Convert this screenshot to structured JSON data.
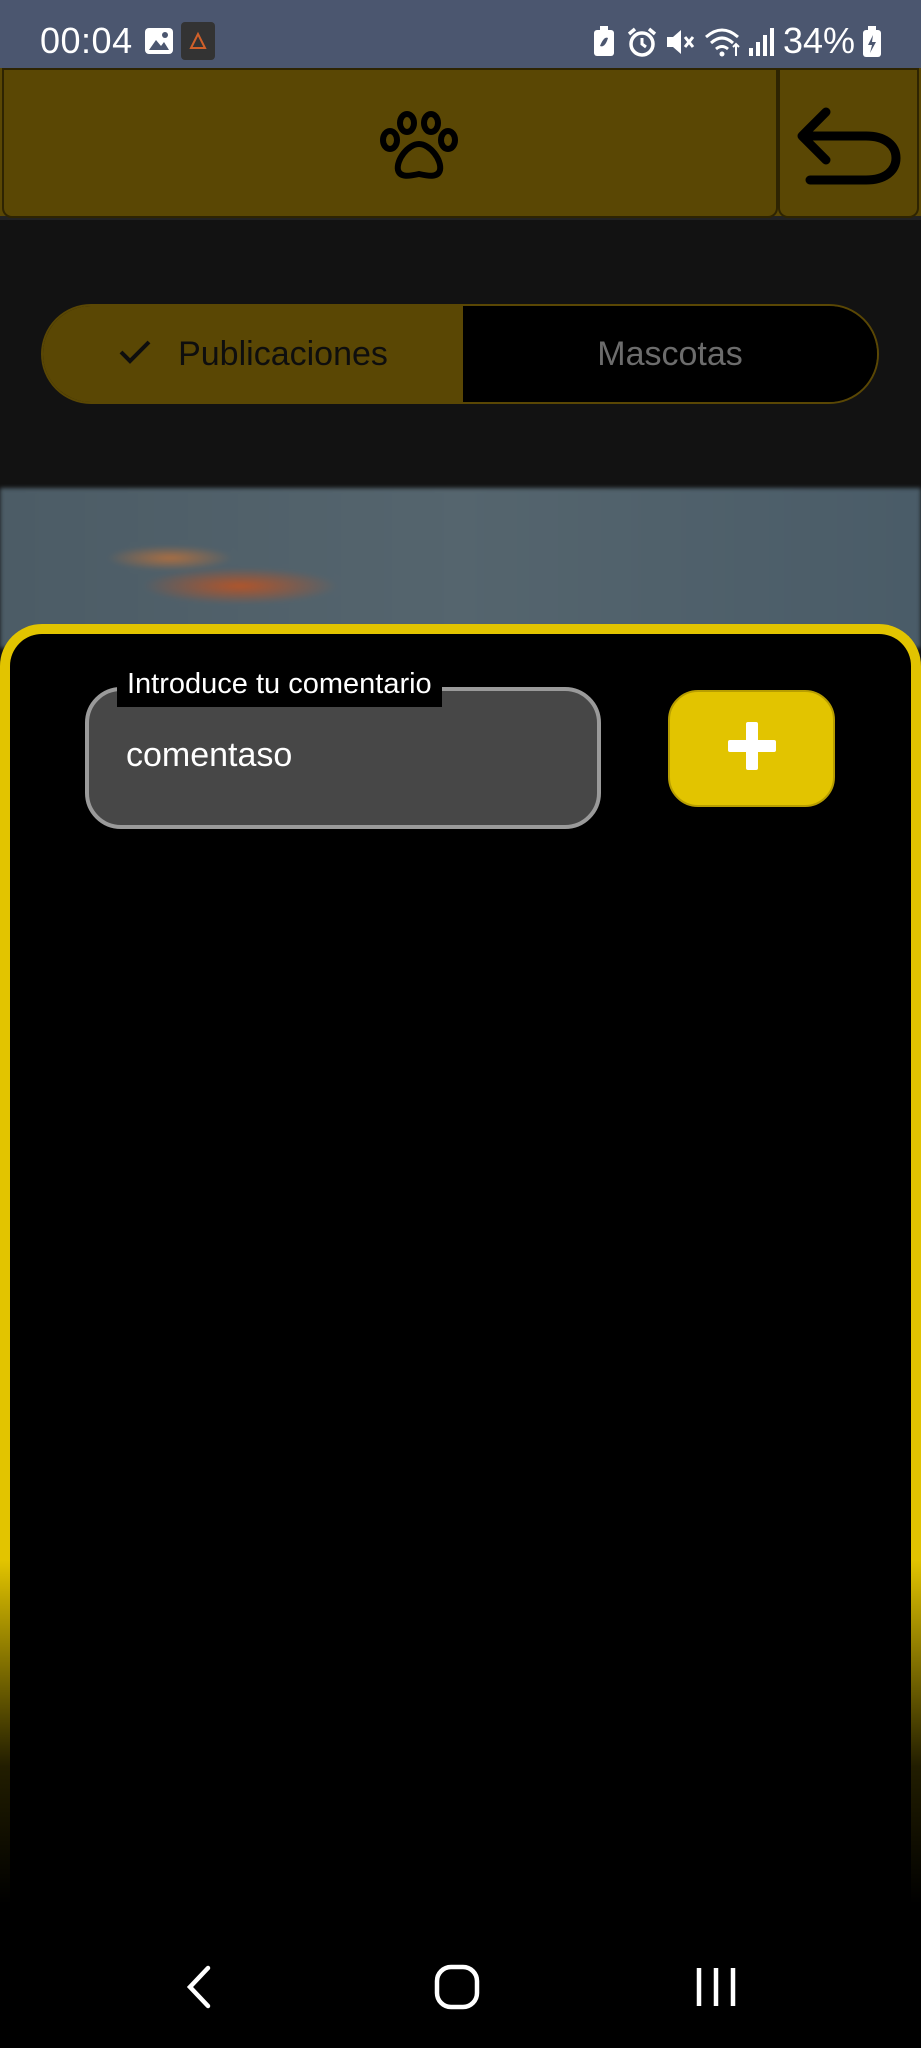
{
  "status_bar": {
    "time": "00:04",
    "battery": "34%",
    "icons": [
      "image-icon",
      "app-notification-icon",
      "battery-saver-icon",
      "alarm-icon",
      "mute-icon",
      "wifi-icon",
      "signal-icon",
      "battery-charging-icon"
    ]
  },
  "header": {
    "logo_icon": "paw-icon",
    "back_icon": "undo-arrow-icon"
  },
  "tabs": {
    "items": [
      {
        "label": "Publicaciones",
        "selected": true,
        "icon": "check-icon"
      },
      {
        "label": "Mascotas",
        "selected": false
      }
    ]
  },
  "comment": {
    "label": "Introduce tu comentario",
    "value": "comentaso",
    "add_icon": "plus-icon"
  },
  "colors": {
    "accent": "#e2c400",
    "header_dim": "#5a4704",
    "status_bar": "#4b566f"
  },
  "nav_bar": {
    "icons": [
      "back-nav-icon",
      "home-nav-icon",
      "recents-nav-icon"
    ]
  }
}
